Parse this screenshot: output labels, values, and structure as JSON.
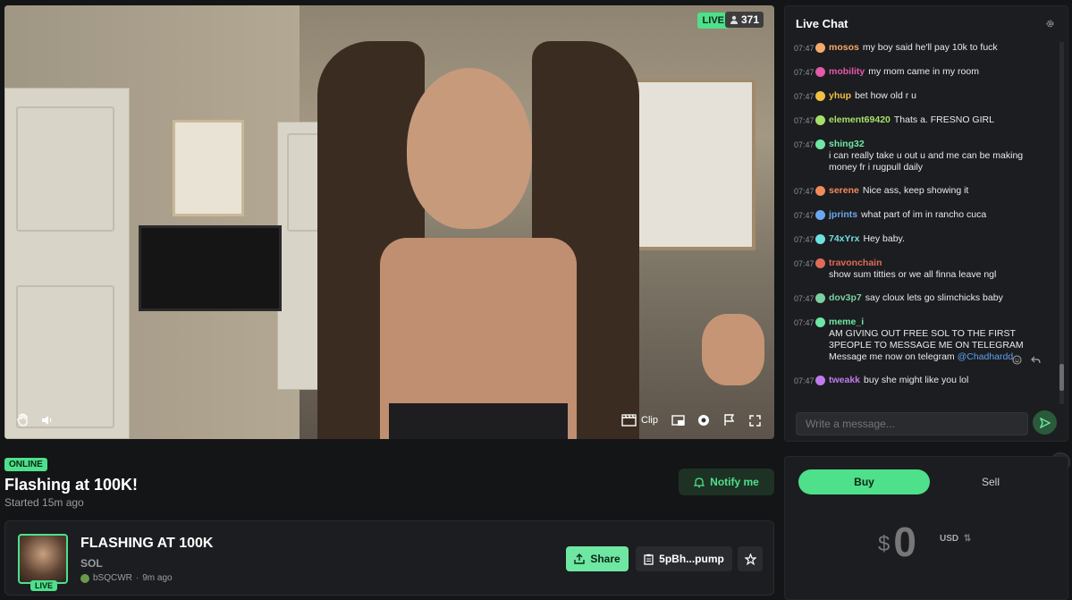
{
  "video": {
    "live_badge": "LIVE",
    "viewer_count": "371",
    "clip_label": "Clip"
  },
  "chat": {
    "title": "Live Chat",
    "input_placeholder": "Write a message...",
    "messages": [
      {
        "time": "07:47",
        "user": "mosos",
        "color": "#f5a96b",
        "text": "my boy said he'll pay 10k to fuck"
      },
      {
        "time": "07:47",
        "user": "mobility",
        "color": "#e25aa8",
        "text": "my mom came in my room"
      },
      {
        "time": "07:47",
        "user": "yhup",
        "color": "#f0c040",
        "text": "bet how old r u"
      },
      {
        "time": "07:47",
        "user": "element69420",
        "color": "#a6e06a",
        "text": "Thats a. FRESNO GIRL"
      },
      {
        "time": "07:47",
        "user": "shing32",
        "color": "#6ee7a3",
        "text": "i can really take u out u and me can be making money fr i rugpull daily"
      },
      {
        "time": "07:47",
        "user": "serene",
        "color": "#f08a5a",
        "text": "Nice ass, keep showing it"
      },
      {
        "time": "07:47",
        "user": "jprints",
        "color": "#6aa8f0",
        "text": "what part of im in rancho cuca"
      },
      {
        "time": "07:47",
        "user": "74xYrx",
        "color": "#6ee0e0",
        "text": "Hey baby."
      },
      {
        "time": "07:47",
        "user": "travonchain",
        "color": "#e06a5a",
        "text": "show sum titties or we all finna leave ngl"
      },
      {
        "time": "07:47",
        "user": "dov3p7",
        "color": "#7ad0a0",
        "text": "say cloux lets go slimchicks baby"
      },
      {
        "time": "07:47",
        "user": "meme_i",
        "color": "#6ee7a3",
        "text": "AM GIVING OUT FREE SOL TO THE FIRST 3PEOPLE TO MESSAGE ME ON TELEGRAM Message me now on telegram",
        "mention": "@Chadhardd"
      },
      {
        "time": "07:47",
        "user": "tweakk",
        "color": "#c07af0",
        "text": "buy she might like you lol"
      }
    ]
  },
  "stream": {
    "status": "ONLINE",
    "title": "Flashing at 100K!",
    "started": "Started 15m ago",
    "notify_label": "Notify me"
  },
  "token": {
    "name": "FLASHING AT 100K",
    "symbol": "SOL",
    "live_badge": "LIVE",
    "creator": "bSQCWR",
    "age": "9m ago",
    "share_label": "Share",
    "contract": "5pBh...pump"
  },
  "trade": {
    "buy_label": "Buy",
    "sell_label": "Sell",
    "currency_symbol": "$",
    "amount": "0",
    "currency": "USD"
  }
}
